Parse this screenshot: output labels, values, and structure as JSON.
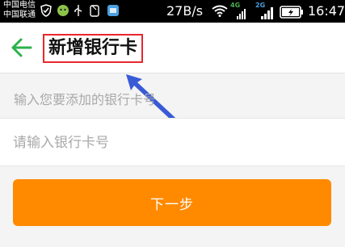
{
  "status_bar": {
    "carrier_1": "中国电信",
    "carrier_2": "中国联通",
    "net_speed": "27B/s",
    "net_type_1": "4G",
    "net_type_2": "2G",
    "time": "16:47",
    "icons": [
      "shield-icon",
      "face-icon",
      "usb-icon",
      "phone-icon",
      "app-icon",
      "wifi-icon",
      "signal-icon",
      "battery-icon"
    ]
  },
  "header": {
    "back_icon": "back-arrow-icon",
    "title": "新增银行卡"
  },
  "form": {
    "hint": "输入您要添加的银行卡号",
    "card_number": {
      "value": "",
      "placeholder": "请输入银行卡号"
    }
  },
  "actions": {
    "next_label": "下一步"
  },
  "colors": {
    "accent": "#ff8a00",
    "back_arrow": "#2bb24c",
    "title_highlight": "#e8272c",
    "annotation_arrow": "#3a5bd6"
  }
}
